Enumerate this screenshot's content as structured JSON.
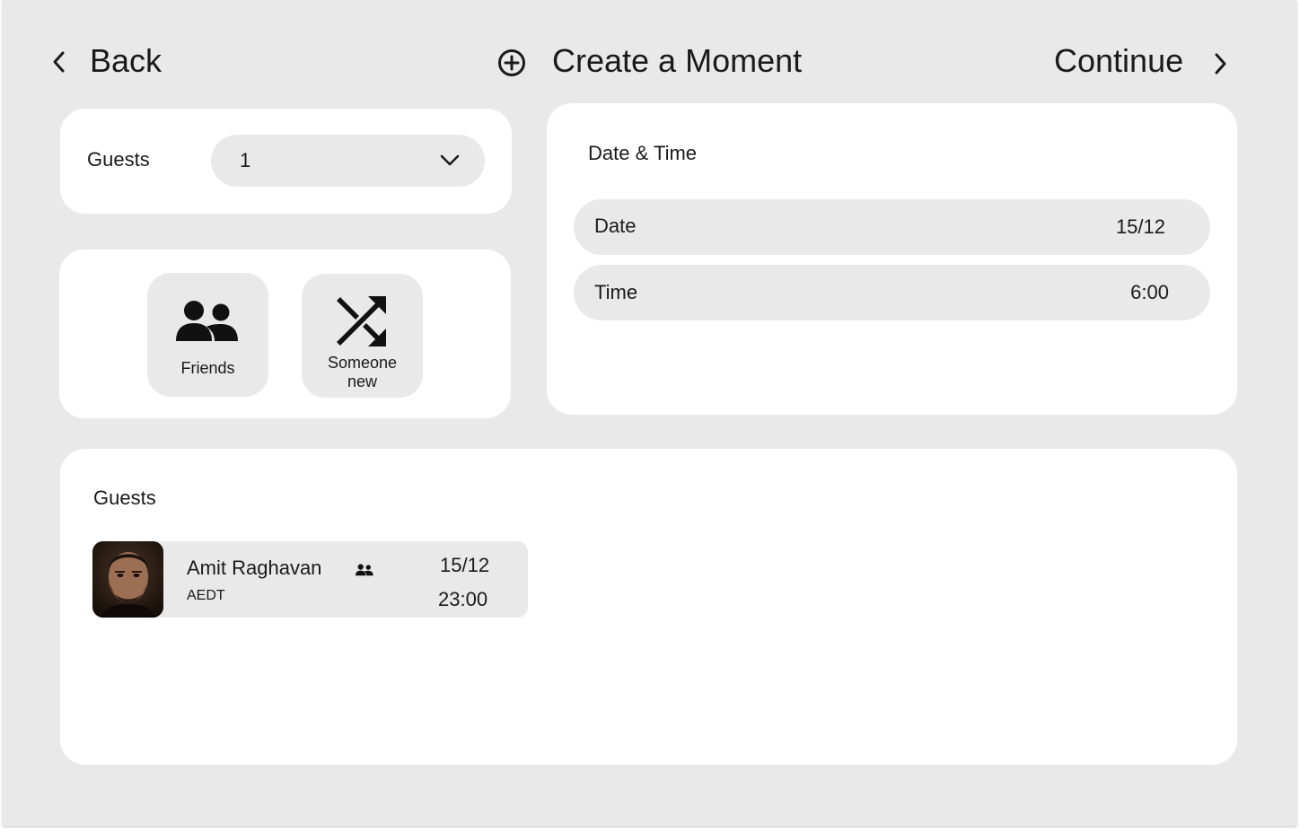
{
  "header": {
    "back_label": "Back",
    "title": "Create a Moment",
    "continue_label": "Continue",
    "icons": {
      "back": "chevron-left-icon",
      "title": "add-circle-icon",
      "continue": "chevron-right-icon"
    }
  },
  "guests_select": {
    "label": "Guests",
    "value": "1",
    "icon": "chevron-down-icon"
  },
  "invite_options": [
    {
      "label": "Friends",
      "icon": "people-icon"
    },
    {
      "label_line1": "Someone",
      "label_line2": "new",
      "icon": "shuffle-icon"
    }
  ],
  "date_time": {
    "title": "Date & Time",
    "date_label": "Date",
    "date_value": "15/12",
    "time_label": "Time",
    "time_value": "6:00"
  },
  "guests_list": {
    "title": "Guests",
    "items": [
      {
        "name": "Amit Raghavan",
        "timezone": "AEDT",
        "date": "15/12",
        "time": "23:00",
        "badge_icon": "people-icon",
        "avatar": "avatar-photo"
      }
    ]
  },
  "colors": {
    "background": "#e9e9e9",
    "card": "#ffffff",
    "pill": "#e9e9e9",
    "text": "#1a1a1a"
  }
}
